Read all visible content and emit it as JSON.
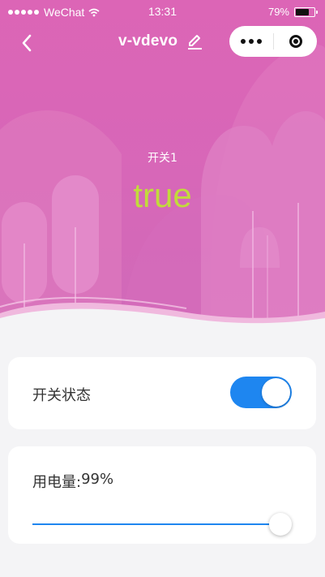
{
  "status_bar": {
    "carrier": "WeChat",
    "time": "13:31",
    "battery_percent": "79%",
    "battery_level": 0.79
  },
  "nav": {
    "title": "v-vdevo",
    "back_icon": "chevron-left-icon",
    "edit_icon": "pencil-icon",
    "more_icon": "more-dots-icon",
    "close_icon": "target-close-icon"
  },
  "hero": {
    "sensor_name": "开关1",
    "sensor_value": "true",
    "value_color": "#c2da3c",
    "background_color": "#d767b8"
  },
  "switch_card": {
    "label": "开关状态",
    "state": true,
    "accent_color": "#1e86f0"
  },
  "power_card": {
    "label_prefix": "用电量:",
    "value_text": "99%",
    "slider_value": 0.99
  }
}
